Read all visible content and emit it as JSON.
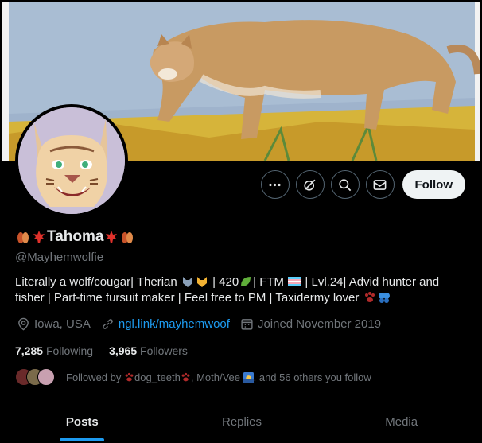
{
  "profile": {
    "display_name": "Tahoma",
    "handle": "@Mayhemwolfie",
    "bio_line1": "Literally a wolf/cougar| Therian",
    "bio_seg2": "| 420",
    "bio_seg3": "| FTM",
    "bio_seg4": "| Lvl.24| Advid hunter and",
    "bio_line2": "fisher | Part-time fursuit maker | Feel free to PM | Taxidermy lover",
    "location": "Iowa, USA",
    "website": "ngl.link/mayhemwoof",
    "joined": "Joined November 2019"
  },
  "stats": {
    "following_count": "7,285",
    "following_label": "Following",
    "followers_count": "3,965",
    "followers_label": "Followers"
  },
  "followed_by": {
    "prefix": "Followed by",
    "name1": "dog_teeth",
    "name2": ", Moth/Vee",
    "suffix": ", and 56 others you follow"
  },
  "actions": {
    "follow_label": "Follow"
  },
  "tabs": [
    {
      "label": "Posts"
    },
    {
      "label": "Replies"
    },
    {
      "label": "Media"
    }
  ],
  "colors": {
    "accent": "#1d9bf0",
    "muted": "#71767b",
    "background": "#000000"
  },
  "icons": [
    "more-icon",
    "grok-icon",
    "search-icon",
    "message-icon",
    "location-icon",
    "link-icon",
    "calendar-icon"
  ]
}
